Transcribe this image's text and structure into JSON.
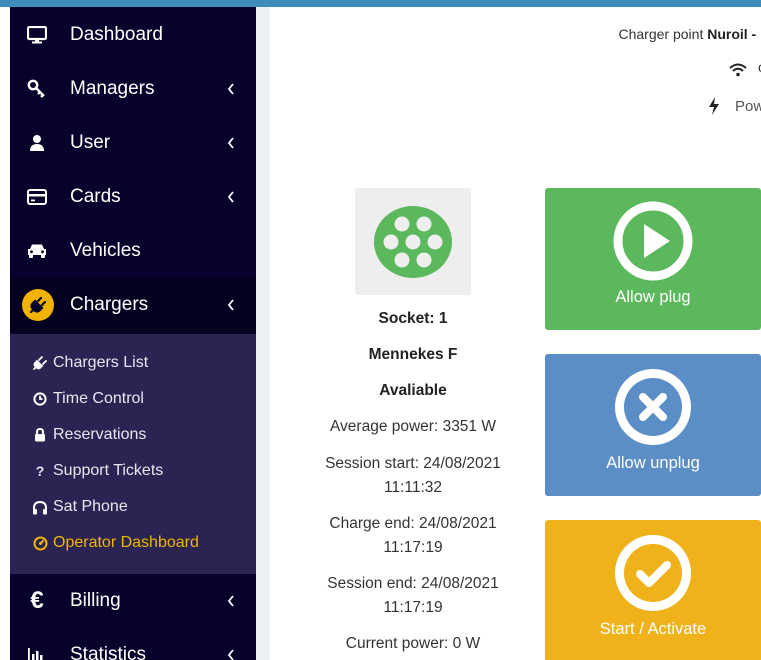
{
  "sidebar": {
    "items": [
      {
        "label": "Dashboard",
        "icon": "monitor-icon",
        "has_children": false
      },
      {
        "label": "Managers",
        "icon": "key-icon",
        "has_children": true
      },
      {
        "label": "User",
        "icon": "user-icon",
        "has_children": true
      },
      {
        "label": "Cards",
        "icon": "credit-card-icon",
        "has_children": true
      },
      {
        "label": "Vehicles",
        "icon": "car-icon",
        "has_children": false
      },
      {
        "label": "Chargers",
        "icon": "plug-icon",
        "has_children": true,
        "active": true
      },
      {
        "label": "Billing",
        "icon": "euro-icon",
        "has_children": true
      },
      {
        "label": "Statistics",
        "icon": "bar-chart-icon",
        "has_children": true
      }
    ],
    "submenu": [
      {
        "label": "Chargers List",
        "icon": "plug-icon"
      },
      {
        "label": "Time Control",
        "icon": "clock-icon"
      },
      {
        "label": "Reservations",
        "icon": "lock-icon"
      },
      {
        "label": "Support Tickets",
        "icon": "question-icon"
      },
      {
        "label": "Sat Phone",
        "icon": "headphones-icon"
      },
      {
        "label": "Operator Dashboard",
        "icon": "dashboard-icon",
        "active": true
      }
    ]
  },
  "charger": {
    "point_prefix": "Charger point ",
    "point_name": "Nuroil - I",
    "status_cut": "c",
    "power_cut": "Pow"
  },
  "socket": {
    "title": "Socket: 1",
    "type": "Mennekes F",
    "status": "Avaliable",
    "average_power": "Average power: 3351 W",
    "session_start_label": "Session start: 24/08/2021",
    "session_start_time": "11:11:32",
    "charge_end_label": "Charge end: 24/08/2021",
    "charge_end_time": "11:17:19",
    "session_end_label": "Session end: 24/08/2021",
    "session_end_time": "11:17:19",
    "current_power": "Current power: 0 W"
  },
  "actions": {
    "allow_plug": "Allow plug",
    "allow_unplug": "Allow unplug",
    "start_activate": "Start / Activate"
  },
  "colors": {
    "sidebar_bg": "#07012b",
    "submenu_bg": "#2b2452",
    "accent": "#f0b400",
    "green": "#5cb85c",
    "blue": "#5b8ec7",
    "yellow": "#f0b21b",
    "topbar": "#3c8dbc"
  }
}
